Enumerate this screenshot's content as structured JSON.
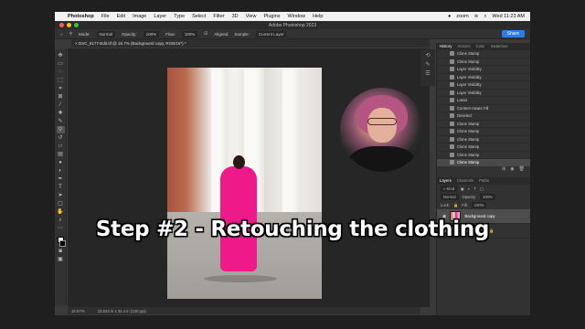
{
  "menubar": {
    "app_name": "Photoshop",
    "items": [
      "File",
      "Edit",
      "Image",
      "Layer",
      "Type",
      "Select",
      "Filter",
      "3D",
      "View",
      "Plugins",
      "Window",
      "Help"
    ],
    "zoom_label": "zoom",
    "clock": "Wed 11:23 AM"
  },
  "window": {
    "title": "Adobe Photoshop 2023",
    "traffic_colors": [
      "#ff5f57",
      "#febc2e",
      "#28c840"
    ]
  },
  "options_bar": {
    "mode_label": "Mode:",
    "mode_value": "Normal",
    "opacity_label": "Opacity:",
    "opacity_value": "100%",
    "flow_label": "Flow:",
    "flow_value": "100%",
    "aligned_label": "Aligned",
    "sample_label": "Sample:",
    "sample_value": "Current Layer",
    "share_label": "Share"
  },
  "document": {
    "tab_title": "DSC_6177-Edit.tif @ 16.7% (Background copy, RGB/16*) *",
    "zoom_status": "16.67%",
    "size_status": "22.833 in x 34.4 in (240 ppi)"
  },
  "caption": "Step #2 - Retouching the clothing",
  "history_panel": {
    "tabs": [
      "History",
      "Actions",
      "Color",
      "Swatches"
    ],
    "items": [
      "Clone Stamp",
      "Clone Stamp",
      "Layer Visibility",
      "Layer Visibility",
      "Layer Visibility",
      "Layer Visibility",
      "Lasso",
      "Content-Aware Fill",
      "Deselect",
      "Clone Stamp",
      "Clone Stamp",
      "Clone Stamp",
      "Clone Stamp",
      "Clone Stamp",
      "Clone Stamp"
    ]
  },
  "layers_panel": {
    "tabs": [
      "Layers",
      "Channels",
      "Paths"
    ],
    "kind_label": "Kind",
    "blend_value": "Normal",
    "opacity_label": "Opacity:",
    "opacity_value": "100%",
    "lock_label": "Lock:",
    "fill_label": "Fill:",
    "fill_value": "100%",
    "layers": [
      {
        "name": "Background copy",
        "selected": true
      },
      {
        "name": "Background",
        "selected": false
      }
    ]
  },
  "colors": {
    "accent": "#2b7de9",
    "dress_pink": "#ee1a8a"
  }
}
